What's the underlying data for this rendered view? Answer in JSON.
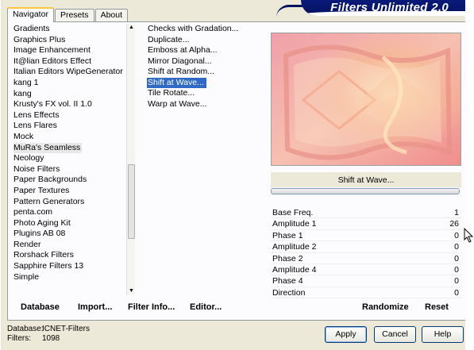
{
  "app": {
    "title": "Filters Unlimited 2.0"
  },
  "tabs": [
    {
      "label": "Navigator",
      "active": true
    },
    {
      "label": "Presets",
      "active": false
    },
    {
      "label": "About",
      "active": false
    }
  ],
  "filter_categories": [
    "Gradients",
    "Graphics Plus",
    "Image Enhancement",
    "It@lian Editors Effect",
    "Italian Editors WipeGenerator",
    "kang 1",
    "kang",
    "Krusty's FX vol. II 1.0",
    "Lens Effects",
    "Lens Flares",
    "Mock",
    "MuRa's Seamless",
    "Neology",
    "Noise Filters",
    "Paper Backgrounds",
    "Paper Textures",
    "Pattern Generators",
    "penta.com",
    "Photo Aging Kit",
    "Plugins AB 08",
    "Render",
    "Rorshack Filters",
    "Sapphire Filters 13",
    "Simple"
  ],
  "selected_category": "MuRa's Seamless",
  "effects": [
    "Checks with Gradation...",
    "Duplicate...",
    "Emboss at Alpha...",
    "Mirror Diagonal...",
    "Shift at Random...",
    "Shift at Wave...",
    "Tile Rotate...",
    "Warp at Wave..."
  ],
  "selected_effect": "Shift at Wave...",
  "preview": {
    "filter_name": "Shift at Wave...",
    "progress": 0
  },
  "params": [
    {
      "label": "Base Freq.",
      "value": "1"
    },
    {
      "label": "Amplitude 1",
      "value": "26"
    },
    {
      "label": "Phase 1",
      "value": "0"
    },
    {
      "label": "Amplitude 2",
      "value": "0"
    },
    {
      "label": "Phase 2",
      "value": "0"
    },
    {
      "label": "Amplitude 4",
      "value": "0"
    },
    {
      "label": "Phase 4",
      "value": "0"
    },
    {
      "label": "Direction",
      "value": "0"
    }
  ],
  "bottom_links": {
    "database": "Database",
    "import": "Import...",
    "filter_info": "Filter Info...",
    "editor": "Editor...",
    "randomize": "Randomize",
    "reset": "Reset"
  },
  "footer": {
    "database_label": "Database:",
    "database_value": "ICNET-Filters",
    "filters_label": "Filters:",
    "filters_value": "1098"
  },
  "buttons": {
    "apply": "Apply",
    "cancel": "Cancel",
    "help": "Help"
  },
  "colors": {
    "accent": "#316ac5",
    "banner": "#05125e",
    "tab_highlight": "#ffc83c"
  }
}
